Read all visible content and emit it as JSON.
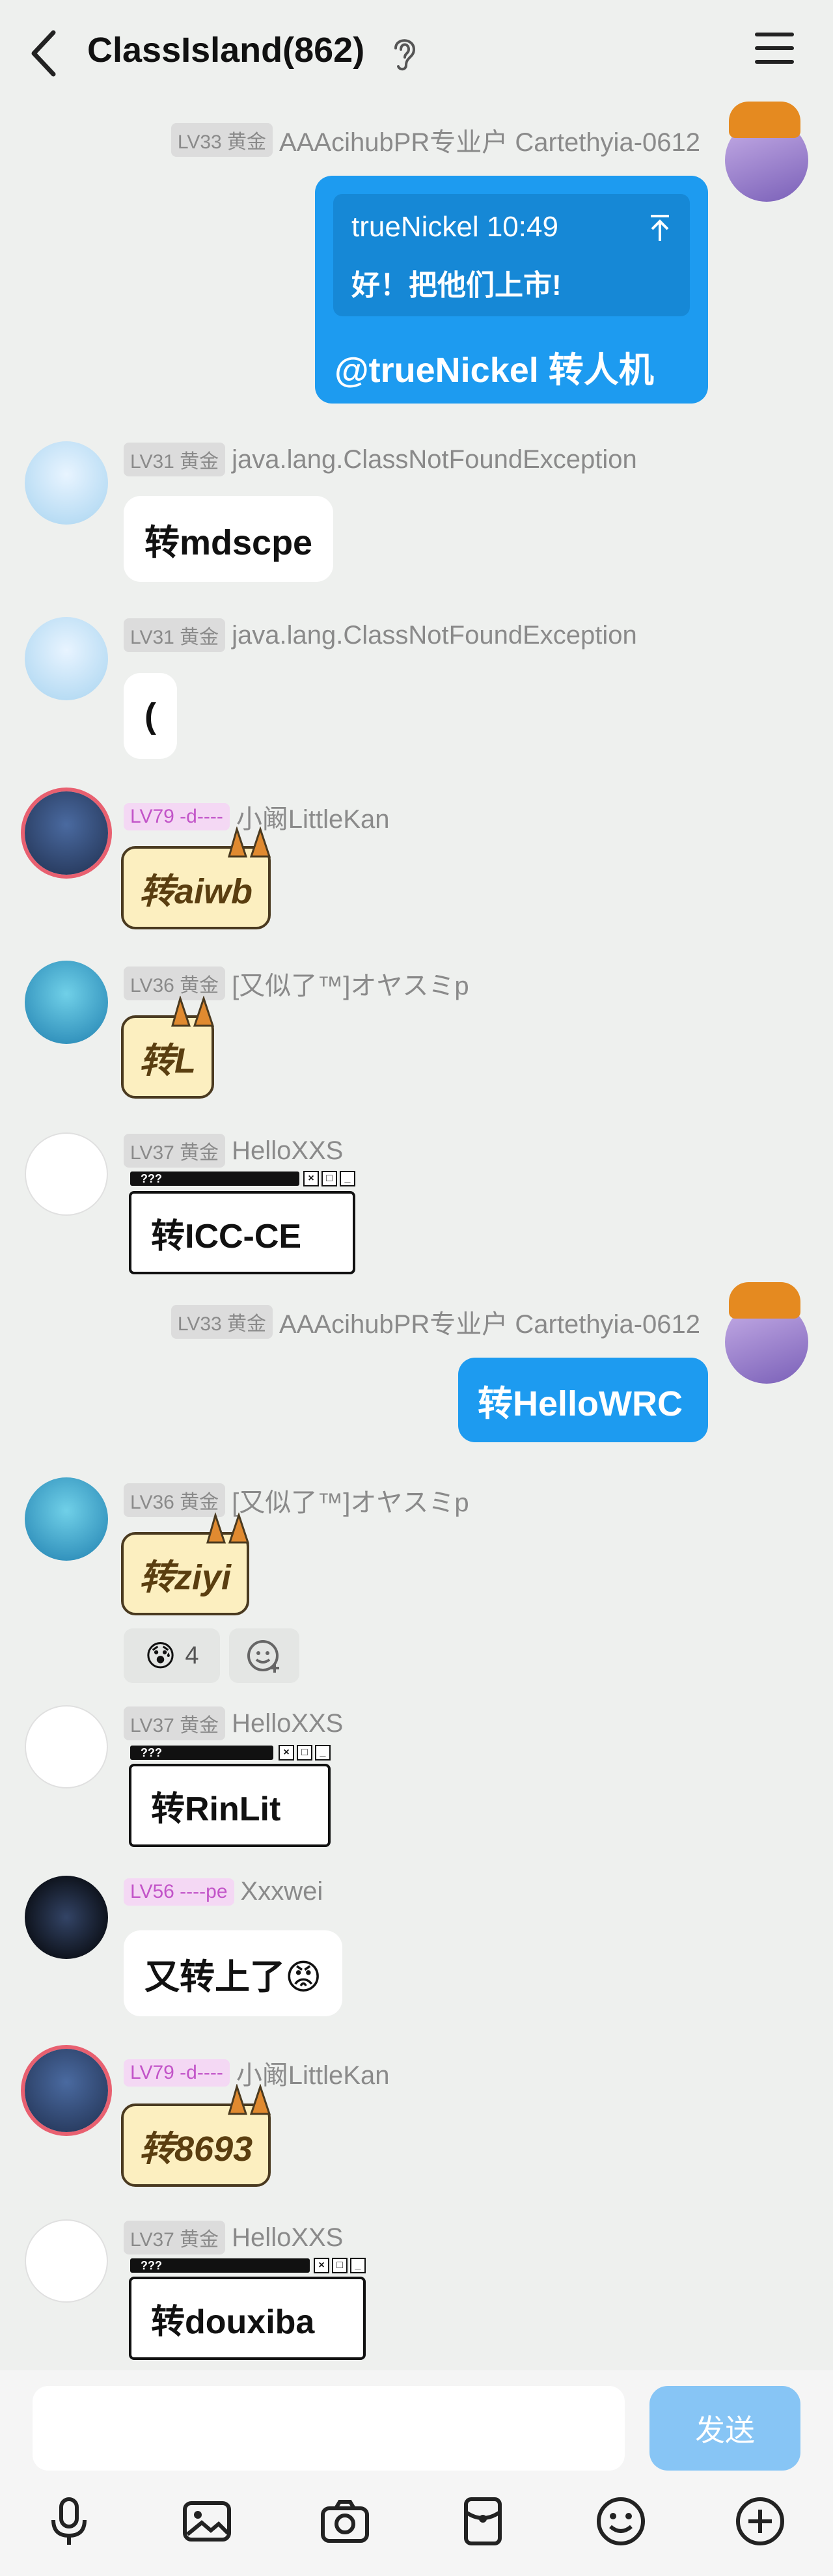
{
  "header": {
    "title": "ClassIsland(862)",
    "back_icon": "chevron-left-icon",
    "ear_icon": "ear-icon",
    "menu_icon": "hamburger-menu-icon"
  },
  "messages": [
    {
      "side": "right",
      "level": "LV33 黄金",
      "nick": "AAAcihubPR专业户 Cartethyia-0612",
      "reply_author": "trueNickel 10:49",
      "reply_text": "好！把他们上市!",
      "text": "@trueNickel 转人机"
    },
    {
      "side": "left",
      "level": "LV31 黄金",
      "nick": "java.lang.ClassNotFoundException",
      "text": "转mdscpe"
    },
    {
      "side": "left",
      "level": "LV31 黄金",
      "nick": "java.lang.ClassNotFoundException",
      "text": "("
    },
    {
      "side": "left",
      "level": "LV79 -d----",
      "nick": "小阚LittleKan",
      "text": "转aiwb"
    },
    {
      "side": "left",
      "level": "LV36 黄金",
      "nick": "[又似了™]オヤスミp",
      "text": "转L"
    },
    {
      "side": "left",
      "level": "LV37 黄金",
      "nick": "HelloXXS",
      "term_title": "???",
      "text": "转ICC-CE"
    },
    {
      "side": "right",
      "level": "LV33 黄金",
      "nick": "AAAcihubPR专业户 Cartethyia-0612",
      "text": "转HelloWRC"
    },
    {
      "side": "left",
      "level": "LV36 黄金",
      "nick": "[又似了™]オヤスミp",
      "text": "转ziyi",
      "reaction_emoji": "😰",
      "reaction_count": "4"
    },
    {
      "side": "left",
      "level": "LV37 黄金",
      "nick": "HelloXXS",
      "term_title": "???",
      "text": "转RinLit"
    },
    {
      "side": "left",
      "level": "LV56 ----pe",
      "nick": "Xxxwei",
      "text": "又转上了😡"
    },
    {
      "side": "left",
      "level": "LV79 -d----",
      "nick": "小阚LittleKan",
      "text": "转8693"
    },
    {
      "side": "left",
      "level": "LV37 黄金",
      "nick": "HelloXXS",
      "term_title": "???",
      "text": "转douxiba"
    }
  ],
  "composer": {
    "input_value": "",
    "send_label": "发送"
  },
  "toolbar": [
    "microphone-icon",
    "image-icon",
    "camera-icon",
    "red-packet-icon",
    "emoji-icon",
    "plus-icon"
  ],
  "colors": {
    "accent": "#1d9bf0",
    "background": "#eef0ee",
    "send_disabled": "#87c5f5"
  }
}
